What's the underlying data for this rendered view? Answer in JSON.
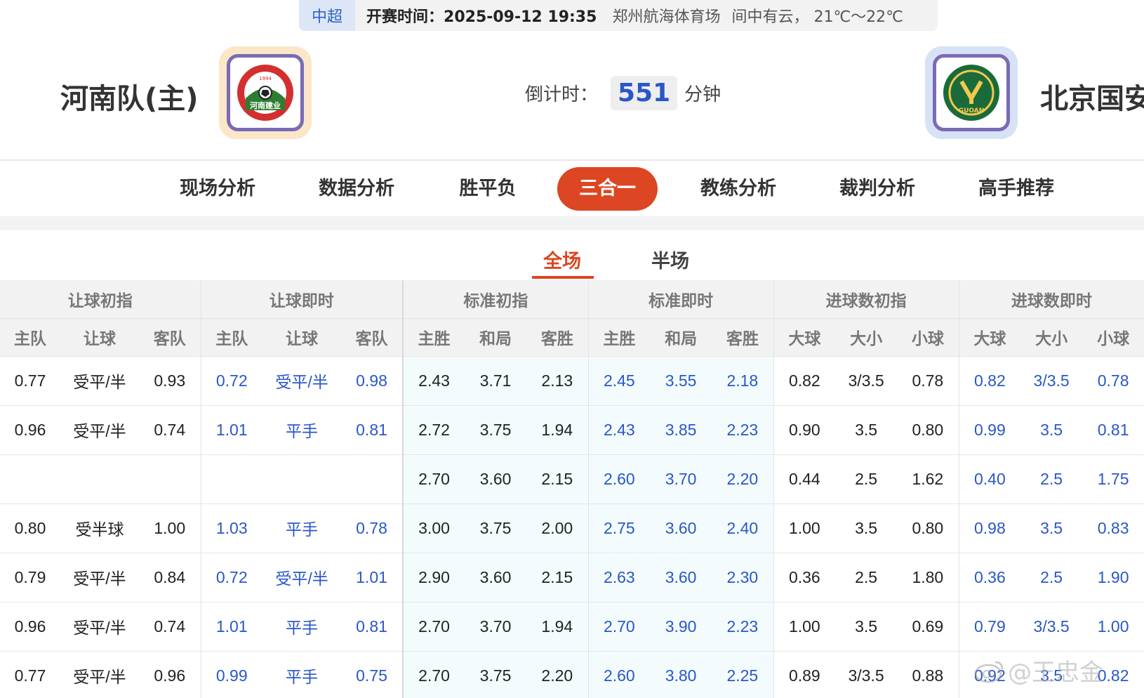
{
  "info": {
    "league": "中超",
    "start_time": "开赛时间：2025-09-12 19:35",
    "venue": "郑州航海体育场",
    "weather": "间中有云， 21℃～22℃"
  },
  "home": {
    "name": "河南队(主)",
    "badge_text": "河南建业",
    "badge_year": "1994"
  },
  "away": {
    "name": "北京国安",
    "badge_text": "GUOAN"
  },
  "countdown": {
    "label": "倒计时：",
    "value": "551",
    "unit": "分钟"
  },
  "nav": {
    "tabs": [
      "现场分析",
      "数据分析",
      "胜平负",
      "三合一",
      "教练分析",
      "裁判分析",
      "高手推荐"
    ],
    "active": "三合一"
  },
  "subtabs": {
    "full": "全场",
    "half": "半场",
    "active": "全场"
  },
  "table": {
    "groups": [
      "让球初指",
      "让球即时",
      "标准初指",
      "标准即时",
      "进球数初指",
      "进球数即时"
    ],
    "subheaders": [
      "主队",
      "让球",
      "客队",
      "主队",
      "让球",
      "客队",
      "主胜",
      "和局",
      "客胜",
      "主胜",
      "和局",
      "客胜",
      "大球",
      "大小",
      "小球",
      "大球",
      "大小",
      "小球"
    ],
    "rows": [
      [
        "0.77",
        "受平/半",
        "0.93",
        "0.72",
        "受平/半",
        "0.98",
        "2.43",
        "3.71",
        "2.13",
        "2.45",
        "3.55",
        "2.18",
        "0.82",
        "3/3.5",
        "0.78",
        "0.82",
        "3/3.5",
        "0.78"
      ],
      [
        "0.96",
        "受平/半",
        "0.74",
        "1.01",
        "平手",
        "0.81",
        "2.72",
        "3.75",
        "1.94",
        "2.43",
        "3.85",
        "2.23",
        "0.90",
        "3.5",
        "0.80",
        "0.99",
        "3.5",
        "0.81"
      ],
      [
        "",
        "",
        "",
        "",
        "",
        "",
        "2.70",
        "3.60",
        "2.15",
        "2.60",
        "3.70",
        "2.20",
        "0.44",
        "2.5",
        "1.62",
        "0.40",
        "2.5",
        "1.75"
      ],
      [
        "0.80",
        "受半球",
        "1.00",
        "1.03",
        "平手",
        "0.78",
        "3.00",
        "3.75",
        "2.00",
        "2.75",
        "3.60",
        "2.40",
        "1.00",
        "3.5",
        "0.80",
        "0.98",
        "3.5",
        "0.83"
      ],
      [
        "0.79",
        "受平/半",
        "0.84",
        "0.72",
        "受平/半",
        "1.01",
        "2.90",
        "3.60",
        "2.15",
        "2.63",
        "3.60",
        "2.30",
        "0.36",
        "2.5",
        "1.80",
        "0.36",
        "2.5",
        "1.90"
      ],
      [
        "0.96",
        "受平/半",
        "0.74",
        "1.01",
        "平手",
        "0.81",
        "2.70",
        "3.70",
        "1.94",
        "2.70",
        "3.90",
        "2.23",
        "1.00",
        "3.5",
        "0.69",
        "0.79",
        "3/3.5",
        "1.00"
      ],
      [
        "0.77",
        "受平/半",
        "0.96",
        "0.99",
        "平手",
        "0.75",
        "2.70",
        "3.75",
        "2.20",
        "2.60",
        "3.80",
        "2.25",
        "0.89",
        "3/3.5",
        "0.88",
        "0.92",
        "3.5",
        "0.82"
      ]
    ]
  },
  "watermark": "@王忠金",
  "colors": {
    "accent": "#dd4622",
    "link_blue": "#2a57c8",
    "shade": "#f3fbfd"
  }
}
